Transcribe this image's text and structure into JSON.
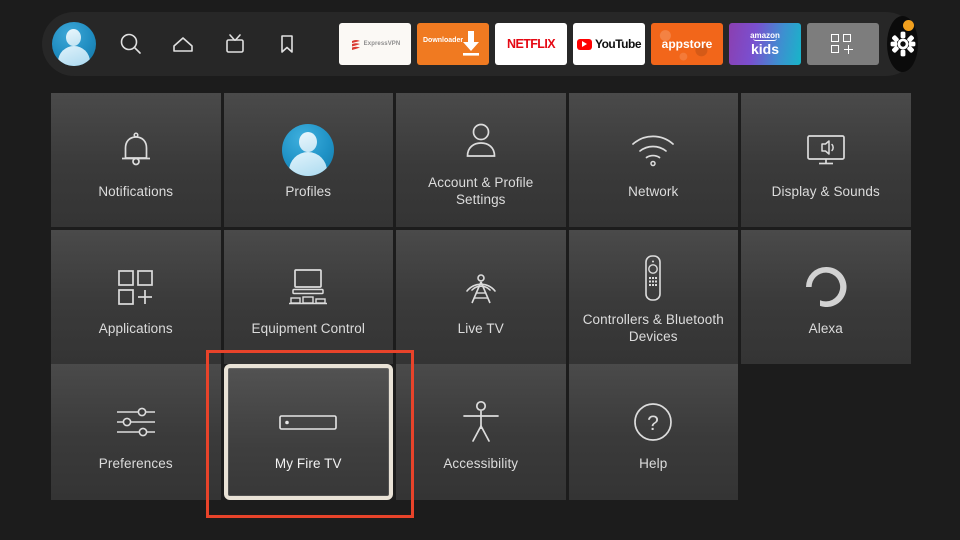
{
  "navbar": {
    "icons": [
      {
        "name": "profile-avatar"
      },
      {
        "name": "search-icon"
      },
      {
        "name": "home-icon"
      },
      {
        "name": "tv-icon"
      },
      {
        "name": "bookmark-icon"
      }
    ],
    "apps": [
      {
        "label": "ExpressVPN",
        "icon": "expressvpn-logo-icon"
      },
      {
        "label": "Downloader",
        "icon": "download-arrow-icon"
      },
      {
        "label": "NETFLIX",
        "icon": "netflix-wordmark"
      },
      {
        "label": "YouTube",
        "icon": "youtube-play-icon"
      },
      {
        "label": "appstore",
        "icon": "appstore-wordmark"
      },
      {
        "label_top": "amazon",
        "label_bottom": "kids",
        "icon": "amazon-kids-wordmark"
      },
      {
        "label": "",
        "icon": "grid-plus-icon"
      }
    ],
    "settings_button": {
      "icon": "gear-icon",
      "badge": true,
      "badge_color": "#f2a01e"
    }
  },
  "grid": {
    "columns": 5,
    "tiles": [
      {
        "label": "Notifications",
        "icon": "bell-icon",
        "focused": false
      },
      {
        "label": "Profiles",
        "icon": "profile-avatar-icon",
        "focused": false
      },
      {
        "label": "Account & Profile Settings",
        "icon": "person-icon",
        "focused": false
      },
      {
        "label": "Network",
        "icon": "wifi-icon",
        "focused": false
      },
      {
        "label": "Display & Sounds",
        "icon": "display-speaker-icon",
        "focused": false
      },
      {
        "label": "Applications",
        "icon": "applications-grid-icon",
        "focused": false
      },
      {
        "label": "Equipment Control",
        "icon": "equipment-control-icon",
        "focused": false
      },
      {
        "label": "Live TV",
        "icon": "broadcast-tower-icon",
        "focused": false
      },
      {
        "label": "Controllers & Bluetooth Devices",
        "icon": "remote-control-icon",
        "focused": false
      },
      {
        "label": "Alexa",
        "icon": "alexa-ring-icon",
        "focused": false
      },
      {
        "label": "Preferences",
        "icon": "sliders-icon",
        "focused": false
      },
      {
        "label": "My Fire TV",
        "icon": "fire-tv-stick-icon",
        "focused": true
      },
      {
        "label": "Accessibility",
        "icon": "accessibility-icon",
        "focused": false
      },
      {
        "label": "Help",
        "icon": "help-question-icon",
        "focused": false
      }
    ]
  },
  "annotation": {
    "target": "My Fire TV",
    "color": "#e8432a",
    "style": "rectangle-outline"
  },
  "colors": {
    "background": "#1c1c1c",
    "navbar": "#272727",
    "tile": "#3d3d3d",
    "tile_focus_border": "#e9e2d6",
    "label": "#dcdcdc",
    "accent_orange": "#f2a01e",
    "annotation_red": "#e8432a"
  }
}
